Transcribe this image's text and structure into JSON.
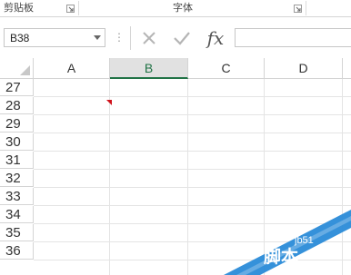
{
  "ribbon": {
    "groups": [
      {
        "label": "剪贴板"
      },
      {
        "label": "字体"
      }
    ]
  },
  "formula_bar": {
    "name_box_value": "B38",
    "dots": "⋮",
    "fx_label": "fx",
    "formula_value": ""
  },
  "grid": {
    "columns": [
      "A",
      "B",
      "C",
      "D"
    ],
    "active_column": "B",
    "rows": [
      "27",
      "28",
      "29",
      "30",
      "31",
      "32",
      "33",
      "34",
      "35",
      "36"
    ],
    "active_cell": "B38"
  },
  "watermark": {
    "text": "脚本",
    "site": "jb51"
  },
  "colors": {
    "accent": "#217346",
    "comment_flag": "#d0121b",
    "watermark_band": "#2a8bd8"
  }
}
